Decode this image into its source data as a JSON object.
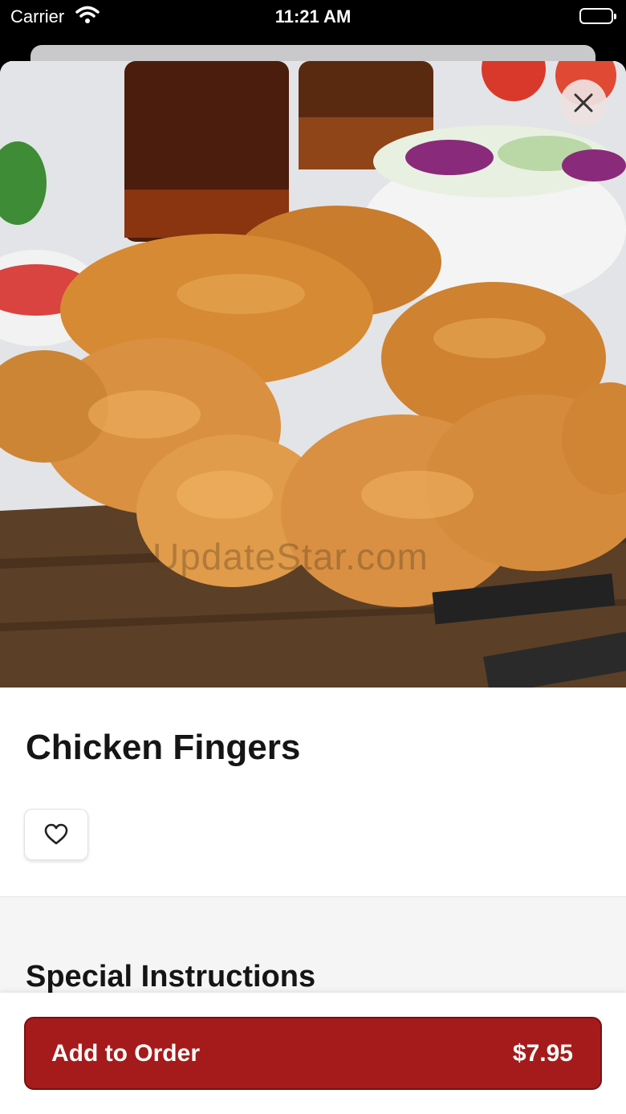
{
  "status_bar": {
    "carrier": "Carrier",
    "time": "11:21 AM",
    "battery_level": 1.0
  },
  "hero": {
    "watermark": "UpdateStar.com",
    "close_icon": "close-icon"
  },
  "item": {
    "title": "Chicken Fingers",
    "favorite_icon": "heart-outline-icon"
  },
  "instructions": {
    "title": "Special Instructions"
  },
  "order": {
    "label": "Add to Order",
    "price": "$7.95"
  },
  "colors": {
    "accent": "#a51b1b",
    "text": "#151515"
  }
}
